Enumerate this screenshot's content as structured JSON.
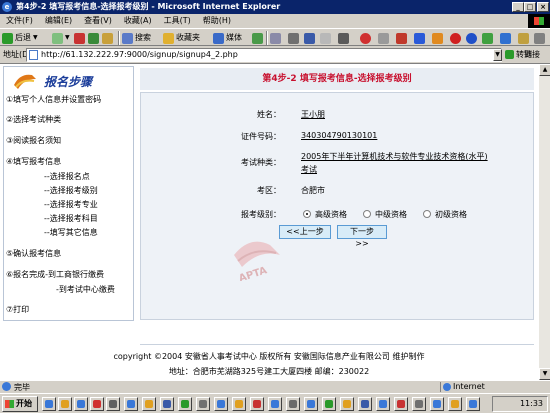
{
  "window": {
    "title": "第4步-2 填写报考信息-选择报考级别 - Microsoft Internet Explorer"
  },
  "menu": [
    "文件(F)",
    "编辑(E)",
    "查看(V)",
    "收藏(A)",
    "工具(T)",
    "帮助(H)"
  ],
  "toolbar": {
    "back": "后退",
    "search": "搜索",
    "favorites": "收藏夹",
    "media": "媒体"
  },
  "address": {
    "label": "地址(D)",
    "url": "http://61.132.222.97:9000/signup/signup4_2.php",
    "go": "转到",
    "links": "链接"
  },
  "sidebar": {
    "title": "报名步骤",
    "items": [
      "①填写个人信息并设置密码",
      "②选择考试种类",
      "③阅读报名须知",
      "④填写报考信息",
      "--选择报名点",
      "--选择报考级别",
      "--选择报考专业",
      "--选择报考科目",
      "--填写其它信息",
      "⑤确认报考信息",
      "⑥报名完成-到工商银行缴费",
      "-到考试中心缴费",
      "⑦打印"
    ]
  },
  "main": {
    "step": "第4步-2",
    "heading": "填写报考信息-选择报考级别",
    "fields": {
      "name_label": "姓名：",
      "name_value": "王小朋",
      "id_label": "证件号码：",
      "id_value": "340304790130101",
      "exam_label": "考试种类：",
      "exam_value_line1": "2005年下半年计算机技术与软件专业技术资格(水平)",
      "exam_value_line2": "考试",
      "area_label": "考区：",
      "area_value": "合肥市",
      "level_label": "报考级别：",
      "levels": [
        "高级资格",
        "中级资格",
        "初级资格"
      ],
      "selected_level": "高级资格"
    },
    "prev_button": "<<上一步",
    "next_button": "下一步>>"
  },
  "footer": {
    "copyright": "copyright ©2004 安徽省人事考试中心 版权所有 安徽国际信息产业有限公司 维护制作",
    "address": "地址：合肥市芜湖路325号建工大厦四楼 邮编：230022"
  },
  "statusbar": {
    "text": "完毕",
    "zone": "Internet"
  },
  "taskbar": {
    "start": "开始",
    "clock": "11:33"
  }
}
